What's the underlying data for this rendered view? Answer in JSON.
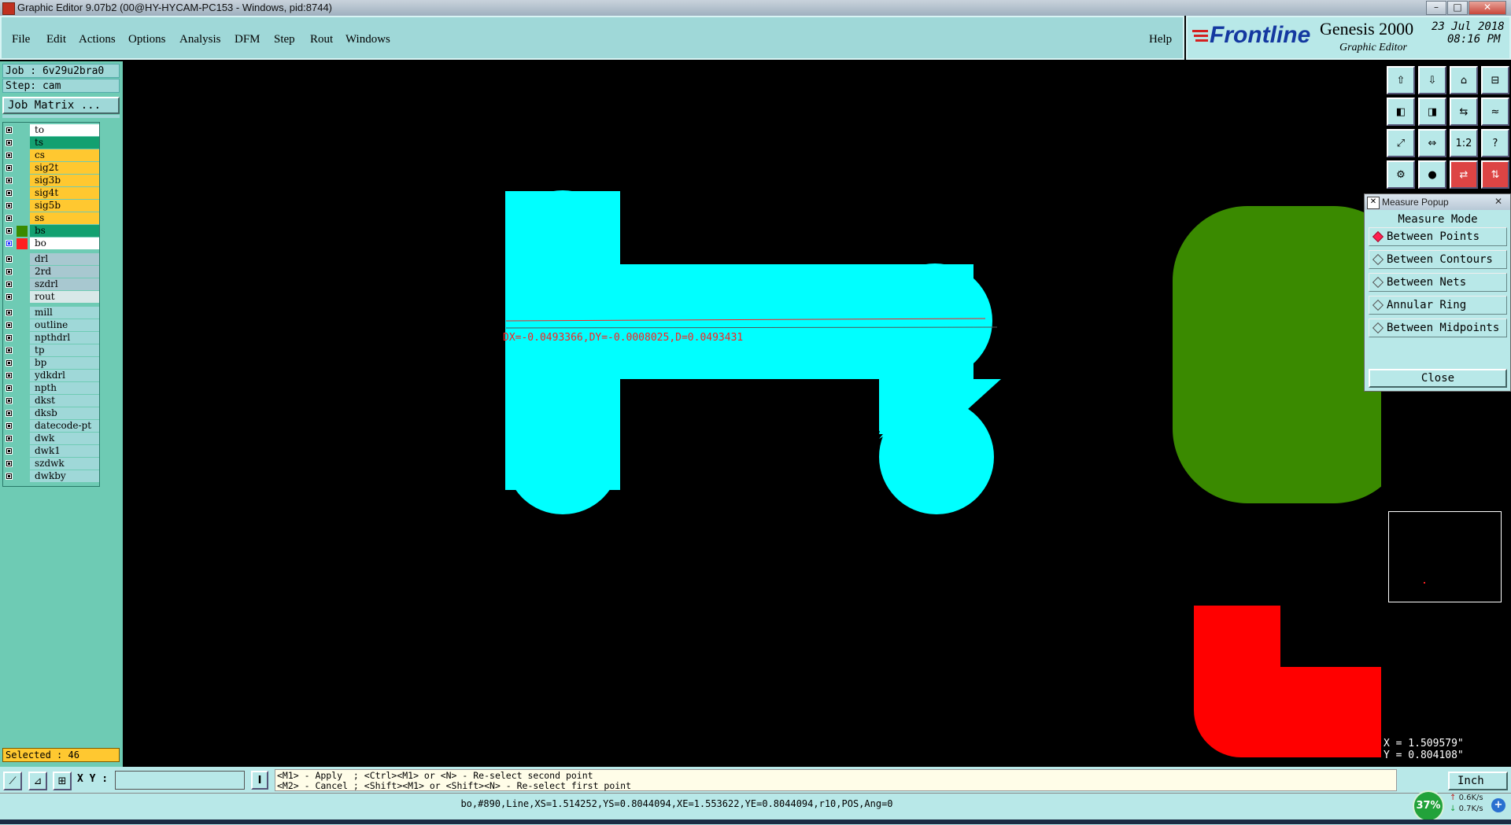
{
  "window": {
    "title": "Graphic Editor 9.07b2 (00@HY-HYCAM-PC153 - Windows, pid:8744)",
    "minimize": "–",
    "maximize": "□",
    "close": "✕"
  },
  "menu": {
    "items": [
      "File",
      "Edit",
      "Actions",
      "Options",
      "Analysis",
      "DFM",
      "Step",
      "Rout",
      "Windows"
    ],
    "help": "Help"
  },
  "brand": {
    "logo": "Frontline",
    "product": "Genesis 2000",
    "subtitle": "Graphic Editor",
    "date": "23 Jul 2018",
    "time": "08:16 PM"
  },
  "job": {
    "job_label": "Job : 6v29u2bra0",
    "step_label": "Step: cam",
    "matrix_button": "Job Matrix ..."
  },
  "layers": [
    {
      "name": "to",
      "color": "#ffffff",
      "swatch": ""
    },
    {
      "name": "ts",
      "color": "#13a070",
      "swatch": ""
    },
    {
      "name": "cs",
      "color": "#ffc830",
      "swatch": ""
    },
    {
      "name": "sig2t",
      "color": "#ffc830",
      "swatch": ""
    },
    {
      "name": "sig3b",
      "color": "#ffc830",
      "swatch": ""
    },
    {
      "name": "sig4t",
      "color": "#ffc830",
      "swatch": ""
    },
    {
      "name": "sig5b",
      "color": "#ffc830",
      "swatch": ""
    },
    {
      "name": "ss",
      "color": "#ffc830",
      "swatch": ""
    },
    {
      "name": "bs",
      "color": "#13a070",
      "swatch": "#3a8a00"
    },
    {
      "name": "bo",
      "color": "#ffffff",
      "swatch": "#ff2020"
    },
    {
      "name": "drl",
      "color": "#a8c8d0",
      "swatch": ""
    },
    {
      "name": "2rd",
      "color": "#a8c8d0",
      "swatch": ""
    },
    {
      "name": "szdrl",
      "color": "#a8c8d0",
      "swatch": ""
    },
    {
      "name": "rout",
      "color": "#d8e8e8",
      "swatch": ""
    },
    {
      "name": "mill",
      "color": "#9fd8d8",
      "swatch": ""
    },
    {
      "name": "outline",
      "color": "#9fd8d8",
      "swatch": ""
    },
    {
      "name": "npthdrl",
      "color": "#9fd8d8",
      "swatch": ""
    },
    {
      "name": "tp",
      "color": "#9fd8d8",
      "swatch": ""
    },
    {
      "name": "bp",
      "color": "#9fd8d8",
      "swatch": ""
    },
    {
      "name": "ydkdrl",
      "color": "#9fd8d8",
      "swatch": ""
    },
    {
      "name": "npth",
      "color": "#9fd8d8",
      "swatch": ""
    },
    {
      "name": "dkst",
      "color": "#9fd8d8",
      "swatch": ""
    },
    {
      "name": "dksb",
      "color": "#9fd8d8",
      "swatch": ""
    },
    {
      "name": "datecode-pt",
      "color": "#9fd8d8",
      "swatch": ""
    },
    {
      "name": "dwk",
      "color": "#9fd8d8",
      "swatch": ""
    },
    {
      "name": "dwk1",
      "color": "#9fd8d8",
      "swatch": ""
    },
    {
      "name": "szdwk",
      "color": "#9fd8d8",
      "swatch": ""
    },
    {
      "name": "dwkby",
      "color": "#9fd8d8",
      "swatch": ""
    }
  ],
  "selected": "Selected : 46",
  "measure_text": "DX=-0.0493366,DY=-0.0008025,D=0.0493431",
  "measure_popup": {
    "title": "Measure Popup",
    "header": "Measure Mode",
    "options": [
      "Between Points",
      "Between Contours",
      "Between Nets",
      "Annular Ring",
      "Between Midpoints"
    ],
    "selected_option": "Between Points",
    "close": "Close"
  },
  "toolbar_icons": [
    "layer-up-icon",
    "layer-down-icon",
    "home-icon",
    "panel-layout-icon",
    "pan-left-icon",
    "pan-right-icon",
    "zoom-back-icon",
    "snap-icon",
    "zoom-fit-icon",
    "zoom-center-icon",
    "scale-icon",
    "help-icon",
    "drill-icon",
    "probe-icon",
    "route-icon",
    "route2-icon"
  ],
  "toolbar_labels": {
    "scale": "1:2",
    "help": "?"
  },
  "coords": {
    "x": "X = 1.509579\"",
    "y": "Y = 0.804108\""
  },
  "xy_label": "X Y :",
  "xy_input": "",
  "prompt_line1": "<M1> - Apply  ; <Ctrl><M1> or <N> - Re-select second point",
  "prompt_line2": "<M2> - Cancel ; <Shift><M1> or <Shift><N> - Re-select first point",
  "unit": "Inch",
  "status": "bo,#890,Line,XS=1.514252,YS=0.8044094,XE=1.553622,YE=0.8044094,r10,POS,Ang=0",
  "net_percent": "37%",
  "net_up": "0.6K/s",
  "net_down": "0.7K/s",
  "colors": {
    "cyan_feature": "#00ffff",
    "green_feature": "#3a8a00",
    "red_feature": "#ff0000",
    "panel": "#9fd8d8",
    "measure_red": "#ff2020"
  }
}
